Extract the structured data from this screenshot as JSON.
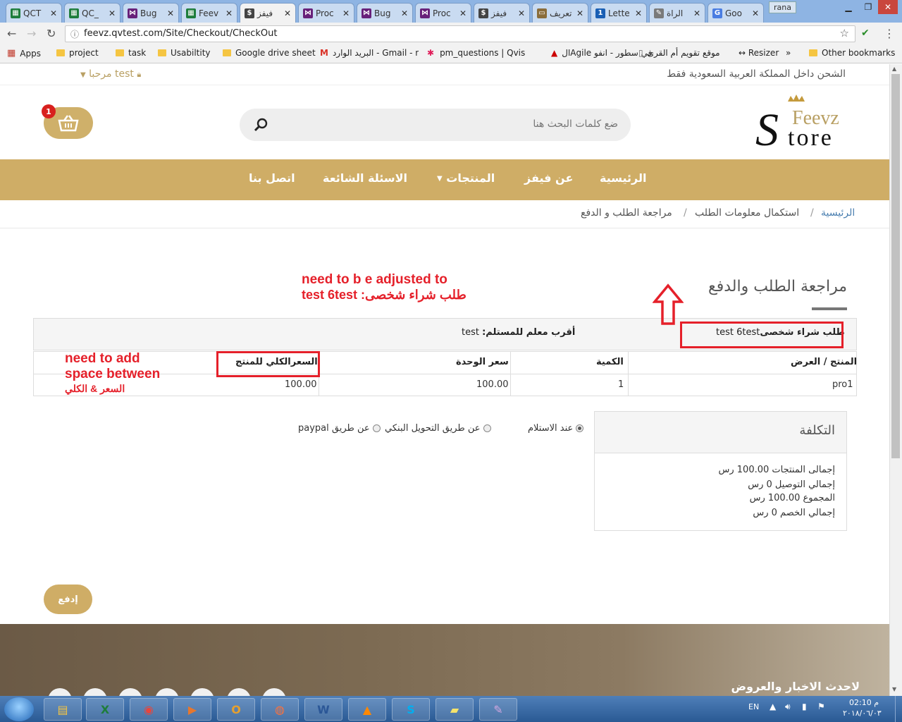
{
  "browser": {
    "tabs": [
      {
        "label": "QCT",
        "color": "#1e7d3c",
        "glyph": "▦"
      },
      {
        "label": "QC_",
        "color": "#1e7d3c",
        "glyph": "▦"
      },
      {
        "label": "Bug",
        "color": "#68217a",
        "glyph": "⋈"
      },
      {
        "label": "Feev",
        "color": "#1e7d3c",
        "glyph": "▦"
      },
      {
        "label": "فيفز",
        "color": "#444444",
        "glyph": "$",
        "active": true
      },
      {
        "label": "Proc",
        "color": "#68217a",
        "glyph": "⋈"
      },
      {
        "label": "Bug",
        "color": "#68217a",
        "glyph": "⋈"
      },
      {
        "label": "Proc",
        "color": "#68217a",
        "glyph": "⋈"
      },
      {
        "label": "فيفز",
        "color": "#444444",
        "glyph": "$"
      },
      {
        "label": "تعريف",
        "color": "#8a6d3b",
        "glyph": "▭"
      },
      {
        "label": "Lette",
        "color": "#1a5fb4",
        "glyph": "1"
      },
      {
        "label": "الراة",
        "color": "#7a7a7a",
        "glyph": "✎"
      },
      {
        "label": "Goo",
        "color": "#4a7de2",
        "glyph": "G"
      }
    ],
    "user": "rana",
    "url": "feevz.qvtest.com/Site/Checkout/CheckOut",
    "bookmarks": [
      {
        "label": "Apps"
      },
      {
        "label": "project"
      },
      {
        "label": "task"
      },
      {
        "label": "Usabiltity"
      },
      {
        "label": "Google drive sheet"
      },
      {
        "label": "البريد الوارد - Gmail - n"
      },
      {
        "label": "pm_questions | Qvis"
      },
      {
        "label": "الAgile في سطور - انفو"
      },
      {
        "label": "موقع تقويم أم القرى"
      },
      {
        "label": "↔ Resizer"
      },
      {
        "label": "»"
      },
      {
        "label": "Other bookmarks"
      }
    ]
  },
  "site": {
    "shipping_notice": "الشحن داخل المملكة العربية السعودية فقط",
    "welcome": "مرحبا test",
    "logo_top": "Feevz",
    "logo_bottom": "tore",
    "logo_s": "S",
    "search_placeholder": "ضع كلمات البحث هنا",
    "cart_count": "1",
    "nav": {
      "home": "الرئيسية",
      "about": "عن فيفز",
      "products": "المنتجات",
      "faq": "الاسئلة الشائعة",
      "contact": "اتصل بنا"
    },
    "breadcrumb": {
      "home": "الرئيسية",
      "sep": "/",
      "info": "استكمال معلومات الطلب",
      "current": "مراجعة الطلب و الدفع"
    },
    "page_title": "مراجعة الطلب والدفع",
    "order": {
      "type_label": "طلب شراء شخصى",
      "type_value": "test 6test",
      "landmark_label": "أقرب معلم للمستلم:",
      "landmark_value": "test"
    },
    "table": {
      "headers": [
        "المنتج / العرض",
        "الكمية",
        "سعر الوحدة",
        "السعرالكلي للمنتج"
      ],
      "rows": [
        [
          "pro1",
          "1",
          "100.00",
          "100.00"
        ]
      ]
    },
    "cost": {
      "title": "التكلفة",
      "lines": [
        "إجمالى المنتجات 100.00 رس",
        "إجمالي التوصيل 0 رس",
        "المجموع 100.00 رس",
        "إجمالي الخصم 0 رس"
      ]
    },
    "payment": {
      "cod": "عند الاستلام",
      "bank": "عن طريق التحويل البنكي",
      "paypal": "عن طريق paypal"
    },
    "pay_button": "إدفع",
    "footer_title": "لاحدث الاخبار والعروض"
  },
  "annotations": {
    "note1_line1": "need to b e adjusted to",
    "note1_line2": "طلب شراء شخصى: test 6test",
    "note2_line1": "need to add",
    "note2_line2": "space between",
    "note2_line3": "السعر & الكلي",
    "color": "#e5202a"
  },
  "taskbar": {
    "lang": "EN",
    "time": "02:10 م",
    "date": "٢٠١٨/٠٦/٠٣"
  }
}
